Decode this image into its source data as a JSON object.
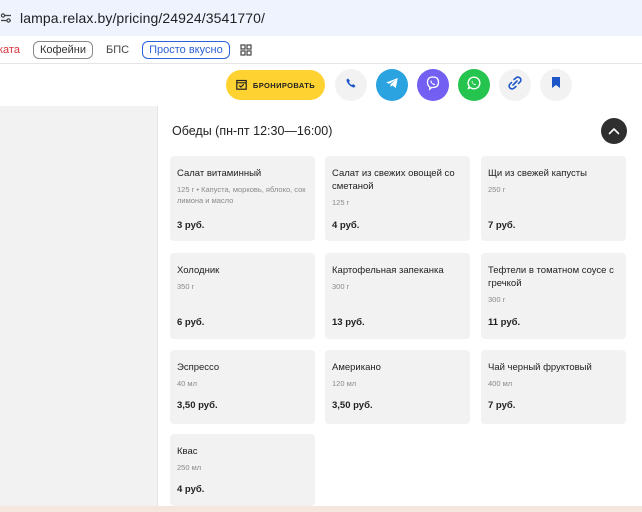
{
  "browser": {
    "url": "lampa.relax.by/pricing/24924/3541770/"
  },
  "bookmarks": {
    "items": [
      "ката",
      "Кофейни",
      "БПС",
      "Просто вкусно"
    ]
  },
  "actions": {
    "book_label": "БРОНИРОВАТЬ",
    "book_color": "#fed331",
    "telegram_color": "#2aa3e0",
    "viber_color": "#7360f2",
    "whatsapp_color": "#25c44e"
  },
  "menu": {
    "title": "Обеды (пн-пт 12:30—16:00)",
    "items": [
      {
        "name": "Салат витаминный",
        "desc": "125 г • Капуста, морковь, яблоко, сок лимона и масло",
        "price": "3 руб."
      },
      {
        "name": "Салат из свежих овощей со сметаной",
        "desc": "125 г",
        "price": "4 руб."
      },
      {
        "name": "Щи из свежей капусты",
        "desc": "250 г",
        "price": "7 руб."
      },
      {
        "name": "Холодник",
        "desc": "350 г",
        "price": "6 руб."
      },
      {
        "name": "Картофельная запеканка",
        "desc": "300 г",
        "price": "13 руб."
      },
      {
        "name": "Тефтели в томатном соусе с гречкой",
        "desc": "300 г",
        "price": "11 руб."
      },
      {
        "name": "Эспрессо",
        "desc": "40 мл",
        "price": "3,50 руб."
      },
      {
        "name": "Американо",
        "desc": "120 мл",
        "price": "3,50 руб."
      },
      {
        "name": "Чай черный фруктовый",
        "desc": "400 мл",
        "price": "7 руб."
      },
      {
        "name": "Квас",
        "desc": "250 мл",
        "price": "4 руб."
      }
    ]
  }
}
